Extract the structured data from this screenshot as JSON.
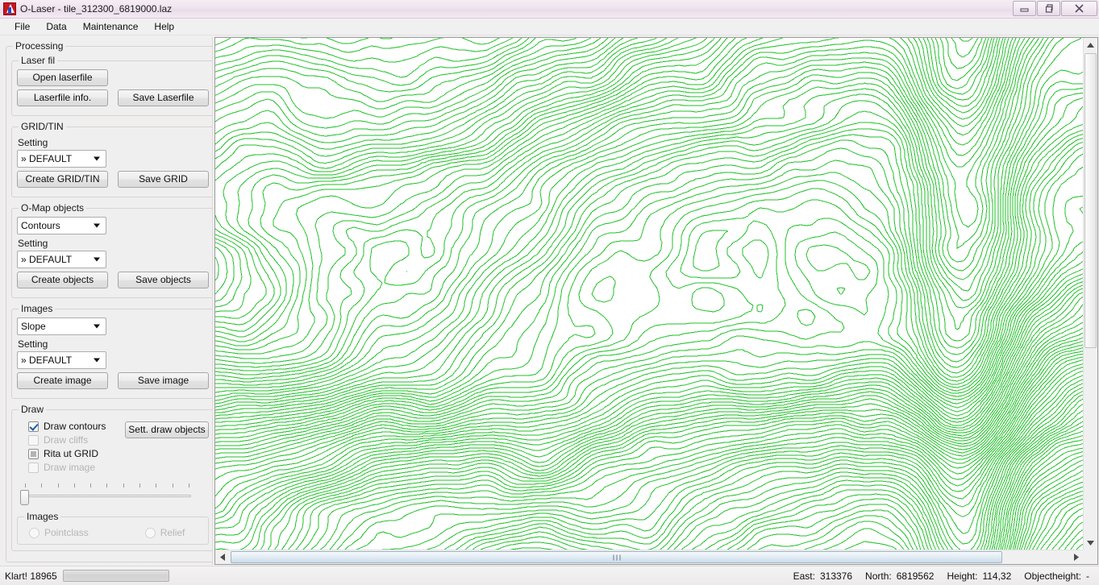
{
  "window": {
    "title": "O-Laser - tile_312300_6819000.laz",
    "icon": "app-icon",
    "minimize_label": "minimize-icon",
    "restore_label": "restore-icon",
    "close_label": "close-icon"
  },
  "menu": {
    "items": [
      {
        "label": "File"
      },
      {
        "label": "Data"
      },
      {
        "label": "Maintenance"
      },
      {
        "label": "Help"
      }
    ]
  },
  "panel": {
    "processing_legend": "Processing",
    "laser_file": {
      "legend": "Laser fil",
      "open_button": "Open laserfile",
      "info_button": "Laserfile info.",
      "save_button": "Save Laserfile"
    },
    "grid_tin": {
      "legend": "GRID/TIN",
      "setting_label": "Setting",
      "setting_value": "» DEFAULT",
      "create_button": "Create GRID/TIN",
      "save_button": "Save GRID"
    },
    "omap_objects": {
      "legend": "O-Map objects",
      "type_value": "Contours",
      "setting_label": "Setting",
      "setting_value": "» DEFAULT",
      "create_button": "Create objects",
      "save_button": "Save objects"
    },
    "images": {
      "legend": "Images",
      "type_value": "Slope",
      "setting_label": "Setting",
      "setting_value": "» DEFAULT",
      "create_button": "Create image",
      "save_button": "Save image"
    },
    "draw": {
      "legend": "Draw",
      "checkboxes": [
        {
          "label": "Draw contours",
          "state": "checked",
          "enabled": true
        },
        {
          "label": "Draw cliffs",
          "state": "unchecked",
          "enabled": false
        },
        {
          "label": "Rita ut GRID",
          "state": "gridfill",
          "enabled": true
        },
        {
          "label": "Draw image",
          "state": "unchecked",
          "enabled": false
        }
      ],
      "settings_button": "Sett. draw objects",
      "slider": {
        "ticks": 11,
        "value": 0
      }
    },
    "images_bottom": {
      "legend": "Images",
      "radios": [
        {
          "label": "Pointclass",
          "selected": false,
          "enabled": false
        },
        {
          "label": "Relief",
          "selected": false,
          "enabled": false
        }
      ]
    }
  },
  "map": {
    "contour_color": "#22c22a",
    "background": "#ffffff",
    "vscroll": {
      "up_icon": "scroll-up-icon",
      "down_icon": "scroll-down-icon"
    },
    "hscroll": {
      "left_icon": "scroll-left-icon",
      "right_icon": "scroll-right-icon"
    }
  },
  "status": {
    "message": "Klart! 18965",
    "progress_percent": 0,
    "east_label": "East:",
    "east_value": "313376",
    "north_label": "North:",
    "north_value": "6819562",
    "height_label": "Height:",
    "height_value": "114,32",
    "objectheight_label": "Objectheight:",
    "objectheight_value": "-"
  }
}
